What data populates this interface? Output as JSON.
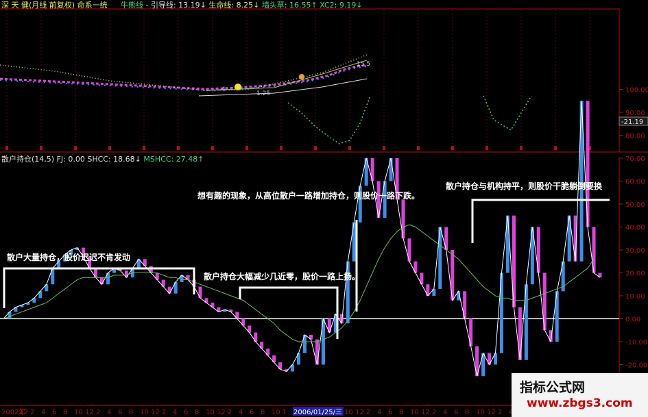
{
  "colors": {
    "background": "#000000",
    "axis_red": "#b01010",
    "up_candle": "#3b8fe8",
    "down_candle": "#e040e0",
    "white_line": "#ffffff",
    "green_ma": "#5fbf5f",
    "annotation": "#ffffff",
    "header_green": "#41d67d",
    "header_yellow": "#e8e84a"
  },
  "top_panel": {
    "title": "深 天 健(月线 前复权) 命系一统",
    "indicators": [
      {
        "name": "牛熊线",
        "value": "",
        "color": "#41d67d"
      },
      {
        "name": "引导线",
        "value": "13.19↓",
        "color": "#dddddd"
      },
      {
        "name": "生命线",
        "value": "8.25↓",
        "color": "#e8e84a"
      },
      {
        "name": "墙头草",
        "value": "16.55↑",
        "color": "#41d67d"
      },
      {
        "name": "XC2",
        "value": "9.19↓",
        "color": "#41d67d"
      }
    ],
    "price_labels": [
      "15.5",
      "4",
      "1.25"
    ],
    "right_value": "-21.19"
  },
  "bottom_panel": {
    "indicator_header": "散户持仓(14,5)",
    "fj": "FJ: 0.00",
    "shcc": "SHCC: 18.68↓",
    "mshcc": "MSHCC: 27.48↑"
  },
  "x_axis": {
    "labels": [
      "2002年",
      "12",
      "2",
      "4",
      "6",
      "8",
      "10",
      "12",
      "2",
      "4",
      "6",
      "8",
      "10",
      "12",
      "2",
      "4",
      "6",
      "8",
      "10",
      "12",
      "2",
      "4",
      "6",
      "8",
      "10",
      "1",
      "2006/01/25/三",
      "10",
      "12",
      "2",
      "4",
      "6",
      "8",
      "10",
      "12",
      "2",
      "4",
      "6",
      "8",
      "10",
      "12",
      "2",
      "4",
      "6",
      "8",
      "10",
      "12",
      "2",
      "4",
      "6",
      "8",
      "10",
      "12"
    ],
    "highlighted": "2006/01/25/三"
  },
  "annotations": [
    "散户大量持仓，股价迟迟不肯发动",
    "散户持仓大幅减少几近零，股价一路上扬。",
    "想有趣的现象，从高位散户一路增加持仓，则股价一路下跌。",
    "散户持仓与机构持平，则股价干脆躺倒要换"
  ],
  "watermark": {
    "line1": "指标公式网",
    "line2": "www.zbgs3.com"
  },
  "chart_data": {
    "type": "bar",
    "title": "散户持仓(14,5)",
    "xlabel": "",
    "ylabel": "",
    "ylim": [
      -30,
      110
    ],
    "yticks": [
      -30,
      -20,
      -10,
      0,
      10,
      20,
      30,
      40,
      50,
      60,
      70,
      80,
      90,
      100
    ],
    "grid": false,
    "series": [
      {
        "name": "SHCC",
        "values": [
          0,
          3,
          5,
          6,
          7,
          9,
          12,
          15,
          22,
          25,
          28,
          30,
          31,
          27,
          22,
          18,
          15,
          20,
          22,
          21,
          18,
          22,
          26,
          23,
          20,
          17,
          14,
          11,
          16,
          19,
          17,
          14,
          9,
          7,
          5,
          3,
          4,
          3,
          0,
          -3,
          -6,
          -10,
          -13,
          -16,
          -19,
          -22,
          -23,
          -20,
          -15,
          -7,
          -9,
          -20,
          0,
          -6,
          2,
          -2,
          25,
          42,
          58,
          70,
          60,
          44,
          60,
          70,
          52,
          35,
          25,
          20,
          15,
          10,
          13,
          40,
          30,
          8,
          12,
          0,
          -12,
          -25,
          -15,
          -20,
          -15,
          20,
          45,
          5,
          -18,
          15,
          40,
          20,
          -5,
          -10,
          12,
          25,
          45,
          25,
          95,
          40,
          20,
          18
        ]
      },
      {
        "name": "MSHCC",
        "values": [
          0,
          1,
          2,
          3,
          4,
          5,
          6,
          7,
          9,
          11,
          13,
          15,
          17,
          18,
          18,
          18,
          18,
          18,
          19,
          19,
          19,
          20,
          20,
          20,
          20,
          20,
          19,
          18,
          18,
          17,
          17,
          16,
          15,
          14,
          13,
          12,
          11,
          10,
          9,
          8,
          6,
          4,
          2,
          0,
          -2,
          -5,
          -7,
          -9,
          -10,
          -10,
          -10,
          -10,
          -9,
          -8,
          -6,
          -4,
          -1,
          3,
          8,
          14,
          20,
          26,
          31,
          35,
          38,
          40,
          41,
          40,
          38,
          36,
          34,
          32,
          30,
          28,
          26,
          23,
          20,
          17,
          14,
          12,
          10,
          9,
          9,
          8,
          8,
          8,
          9,
          10,
          11,
          12,
          13,
          14,
          16,
          18,
          20,
          22,
          26
        ]
      }
    ]
  }
}
